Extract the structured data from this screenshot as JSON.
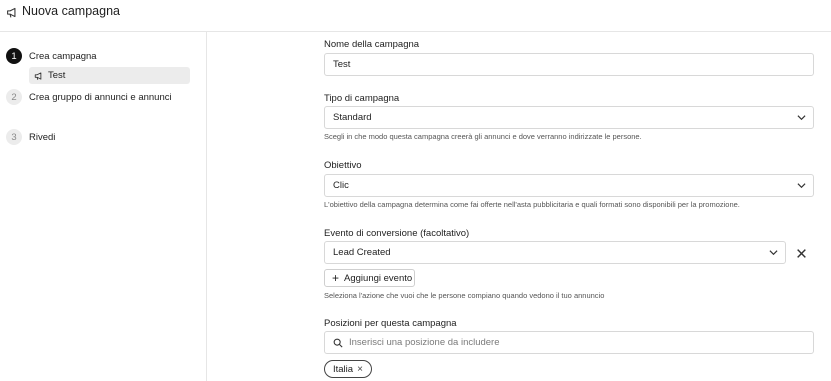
{
  "header": {
    "title": "Nuova campagna",
    "icon": "megaphone-icon"
  },
  "sidebar": {
    "steps": [
      {
        "number": "1",
        "label": "Crea campagna",
        "state": "active"
      },
      {
        "number": "2",
        "label": "Crea gruppo di annunci e annunci",
        "state": "inactive"
      },
      {
        "number": "3",
        "label": "Rivedi",
        "state": "inactive"
      }
    ],
    "sub_item": {
      "label": "Test",
      "icon": "megaphone-icon"
    }
  },
  "form": {
    "name": {
      "label": "Nome della campagna",
      "value": "Test"
    },
    "type": {
      "label": "Tipo di campagna",
      "value": "Standard",
      "hint": "Scegli in che modo questa campagna creerà gli annunci e dove verranno indirizzate le persone."
    },
    "objective": {
      "label": "Obiettivo",
      "value": "Clic",
      "hint": "L'obiettivo della campagna determina come fai offerte nell'asta pubblicitaria e quali formati sono disponibili per la promozione."
    },
    "conversion": {
      "label": "Evento di conversione (facoltativo)",
      "value": "Lead Created",
      "add_button": "Aggiungi evento",
      "hint": "Seleziona l'azione che vuoi che le persone compiano quando vedono il tuo annuncio"
    },
    "positions": {
      "label": "Posizioni per questa campagna",
      "placeholder": "Inserisci una posizione da includere",
      "chips": [
        "Italia"
      ]
    }
  },
  "colors": {
    "active_step": "#111111",
    "border": "#d8d8d8",
    "selected_bg": "#ececec"
  }
}
